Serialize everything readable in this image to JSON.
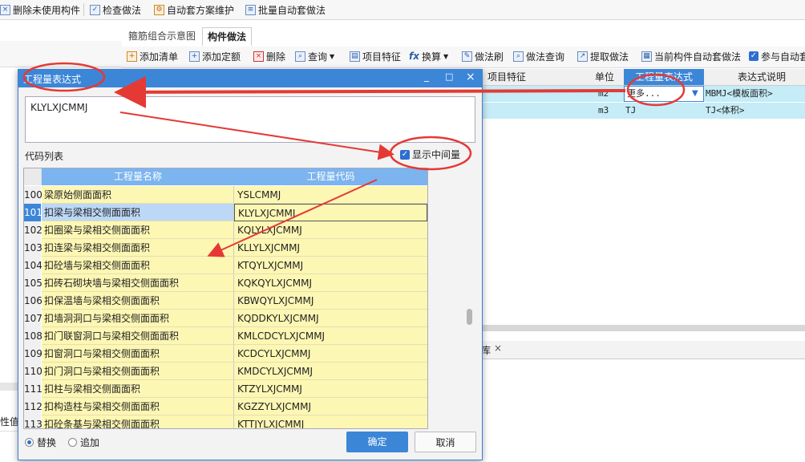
{
  "top_toolbar": {
    "delete_unused": "删除未使用构件",
    "check_method": "检查做法",
    "auto_scheme": "自动套方案维护",
    "batch_auto": "批量自动套做法"
  },
  "tabs": {
    "tab1": "箍筋组合示意图",
    "tab2": "构件做法"
  },
  "toolbar2": {
    "add_list": "添加清单",
    "add_quota": "添加定额",
    "delete": "删除",
    "query": "查询",
    "item_feature": "项目特征",
    "convert": "换算",
    "method_brush": "做法刷",
    "method_query": "做法查询",
    "extract_method": "提取做法",
    "auto_current": "当前构件自动套做法",
    "participate_auto": "参与自动套"
  },
  "grid": {
    "headers": {
      "feature": "项目特征",
      "unit": "单位",
      "expr": "工程量表达式",
      "desc": "表达式说明"
    },
    "rows": [
      {
        "unit": "m2",
        "expr": "更多...",
        "desc": "MBMJ<模板面积>"
      },
      {
        "unit": "m3",
        "expr": "TJ",
        "desc": "TJ<体积>"
      }
    ]
  },
  "side_tab": "库",
  "left_fragment": "性值",
  "dialog": {
    "title": "工程量表达式",
    "expression": "KLYLXJCMMJ",
    "code_list_label": "代码列表",
    "show_intermediate": "显示中间量",
    "col_name": "工程量名称",
    "col_code": "工程量代码",
    "rows": [
      {
        "no": "100",
        "name": "梁原始侧面面积",
        "code": "YSLCMMJ"
      },
      {
        "no": "101",
        "name": "扣梁与梁相交侧面面积",
        "code": "KLYLXJCMMJ"
      },
      {
        "no": "102",
        "name": "扣圈梁与梁相交侧面面积",
        "code": "KQLYLXJCMMJ"
      },
      {
        "no": "103",
        "name": "扣连梁与梁相交侧面面积",
        "code": "KLLYLXJCMMJ"
      },
      {
        "no": "104",
        "name": "扣砼墙与梁相交侧面面积",
        "code": "KTQYLXJCMMJ"
      },
      {
        "no": "105",
        "name": "扣砖石砌块墙与梁相交侧面面积",
        "code": "KQKQYLXJCMMJ"
      },
      {
        "no": "106",
        "name": "扣保温墙与梁相交侧面面积",
        "code": "KBWQYLXJCMMJ"
      },
      {
        "no": "107",
        "name": "扣墙洞洞口与梁相交侧面面积",
        "code": "KQDDKYLXJCMMJ"
      },
      {
        "no": "108",
        "name": "扣门联窗洞口与梁相交侧面面积",
        "code": "KMLCDCYLXJCMMJ"
      },
      {
        "no": "109",
        "name": "扣窗洞口与梁相交侧面面积",
        "code": "KCDCYLXJCMMJ"
      },
      {
        "no": "110",
        "name": "扣门洞口与梁相交侧面面积",
        "code": "KMDCYLXJCMMJ"
      },
      {
        "no": "111",
        "name": "扣柱与梁相交侧面面积",
        "code": "KTZYLXJCMMJ"
      },
      {
        "no": "112",
        "name": "扣构造柱与梁相交侧面面积",
        "code": "KGZZYLXJCMMJ"
      },
      {
        "no": "113",
        "name": "扣砼条基与梁相交侧面面积",
        "code": "KTTJYLXJCMMJ"
      }
    ],
    "replace": "替换",
    "append": "追加",
    "ok": "确定",
    "cancel": "取消"
  },
  "colors": {
    "accent": "#3c86d8",
    "highlight": "#fdf7b4",
    "annotation": "#e53935"
  }
}
